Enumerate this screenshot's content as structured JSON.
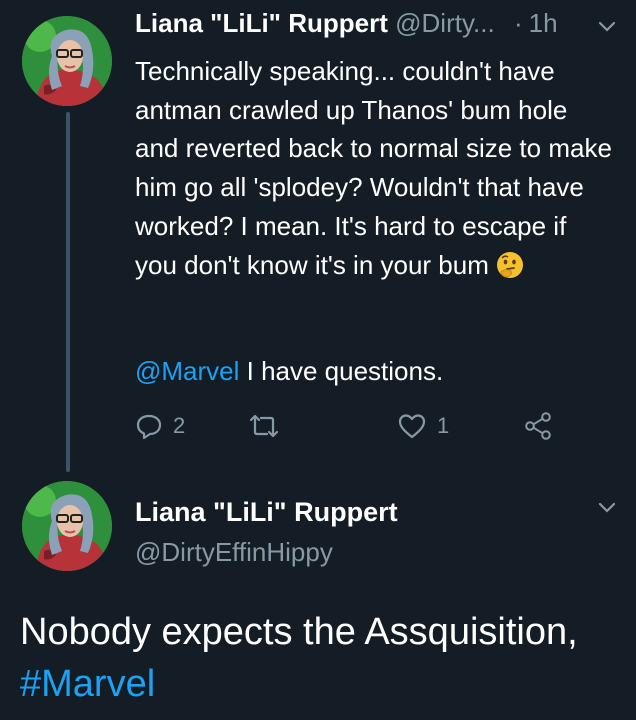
{
  "tweet1": {
    "author_name": "Liana \"LiLi\" Ruppert",
    "author_handle": "@Dirty...",
    "separator": "·",
    "time": "1h",
    "text": "Technically speaking... couldn't have antman crawled up Thanos' bum hole and reverted back to normal size to make him go all 'splodey? Wouldn't that have worked? I mean. It's hard to escape if you don't know it's in your bum",
    "emoji": "thinking-face",
    "mention": "@Marvel",
    "text2": " I have questions.",
    "actions": {
      "reply_count": "2",
      "retweet_count": "",
      "like_count": "1"
    }
  },
  "tweet2": {
    "author_name": "Liana \"LiLi\" Ruppert",
    "author_handle": "@DirtyEffinHippy",
    "text": "Nobody expects the Assquisition, ",
    "hashtag": "#Marvel"
  },
  "colors": {
    "background": "#141d26",
    "text": "#ffffff",
    "muted": "#8899a6",
    "link": "#1da1f2",
    "thread_line": "#3d5466"
  },
  "icons": [
    "reply-icon",
    "retweet-icon",
    "like-icon",
    "share-icon",
    "chevron-down-icon"
  ]
}
